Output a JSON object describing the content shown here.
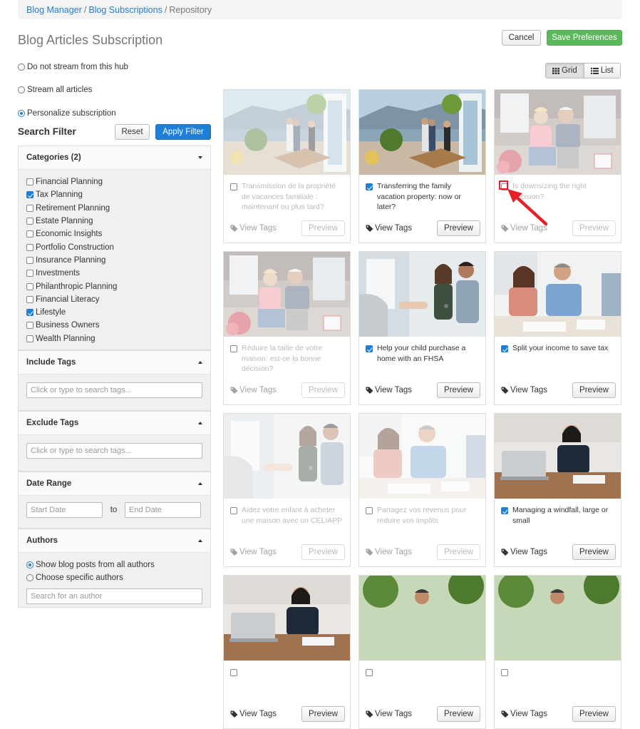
{
  "breadcrumb": {
    "items": [
      "Blog Manager",
      "Blog Subscriptions"
    ],
    "current": "Repository",
    "separator": "/"
  },
  "page": {
    "title": "Blog Articles Subscription",
    "cancel_label": "Cancel",
    "save_label": "Save Preferences"
  },
  "subscription_options": [
    {
      "label": "Do not stream from this hub",
      "selected": false
    },
    {
      "label": "Stream all articles",
      "selected": false
    },
    {
      "label": "Personalize subscription",
      "selected": true
    }
  ],
  "view_toggle": {
    "grid_label": "Grid",
    "list_label": "List",
    "active": "grid"
  },
  "search_filter": {
    "title": "Search Filter",
    "reset_label": "Reset",
    "apply_label": "Apply Filter"
  },
  "categories": {
    "title": "Categories (2)",
    "items": [
      {
        "label": "Financial Planning",
        "checked": false
      },
      {
        "label": "Tax Planning",
        "checked": true
      },
      {
        "label": "Retirement Planning",
        "checked": false
      },
      {
        "label": "Estate Planning",
        "checked": false
      },
      {
        "label": "Economic Insights",
        "checked": false
      },
      {
        "label": "Portfolio Construction",
        "checked": false
      },
      {
        "label": "Insurance Planning",
        "checked": false
      },
      {
        "label": "Investments",
        "checked": false
      },
      {
        "label": "Philanthropic Planning",
        "checked": false
      },
      {
        "label": "Financial Literacy",
        "checked": false
      },
      {
        "label": "Lifestyle",
        "checked": true
      },
      {
        "label": "Business Owners",
        "checked": false
      },
      {
        "label": "Wealth Planning",
        "checked": false
      }
    ]
  },
  "include_tags": {
    "title": "Include Tags",
    "placeholder": "Click or type to search tags..."
  },
  "exclude_tags": {
    "title": "Exclude Tags",
    "placeholder": "Click or type to search tags..."
  },
  "date_range": {
    "title": "Date Range",
    "start_placeholder": "Start Date",
    "to_label": "to",
    "end_placeholder": "End Date"
  },
  "authors": {
    "title": "Authors",
    "options": [
      {
        "label": "Show blog posts from all authors",
        "selected": true
      },
      {
        "label": "Choose specific authors",
        "selected": false
      }
    ],
    "search_placeholder": "Search for an author"
  },
  "card_labels": {
    "view_tags": "View Tags",
    "preview": "Preview"
  },
  "articles": [
    {
      "title": "Transmission de la propriété de vacances familiale : maintenant ou plus tard?",
      "checked": false,
      "faded": true,
      "scene": "terrace"
    },
    {
      "title": "Transferring the family vacation property: now or later?",
      "checked": true,
      "faded": false,
      "scene": "terrace"
    },
    {
      "title": "Is downsizing the right decision?",
      "checked": false,
      "faded": true,
      "scene": "couple-sale"
    },
    {
      "title": "Réduire la taille de votre maison: est-ce la bonne décision?",
      "checked": false,
      "faded": true,
      "scene": "couple-sale"
    },
    {
      "title": "Help your child purchase a home with an FHSA",
      "checked": true,
      "faded": false,
      "scene": "keys"
    },
    {
      "title": "Split your income to save tax",
      "checked": true,
      "faded": false,
      "scene": "meeting"
    },
    {
      "title": "Aidez votre enfant à acheter une maison avec un CELIAPP",
      "checked": false,
      "faded": true,
      "scene": "keys"
    },
    {
      "title": "Partagez vos revenus pour réduire vos impôts",
      "checked": false,
      "faded": true,
      "scene": "meeting"
    },
    {
      "title": "Managing a windfall, large or small",
      "checked": true,
      "faded": false,
      "scene": "laptop"
    },
    {
      "title": "",
      "checked": false,
      "faded": false,
      "scene": "laptop"
    },
    {
      "title": "",
      "checked": false,
      "faded": false,
      "scene": "garden"
    },
    {
      "title": "",
      "checked": false,
      "faded": false,
      "scene": "garden"
    }
  ],
  "colors": {
    "accent_blue": "#1f7fd6",
    "save_green": "#5cb85c",
    "link": "#2a7bc4",
    "annotation_red": "#e5202a"
  }
}
